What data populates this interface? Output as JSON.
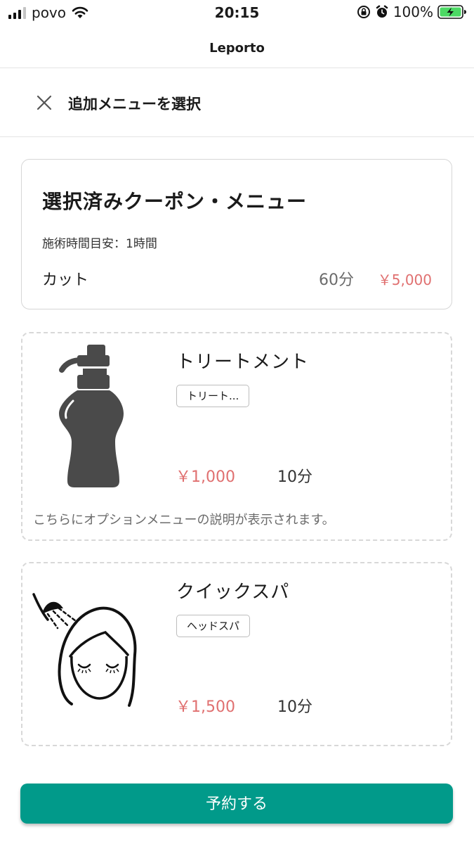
{
  "status_bar": {
    "carrier": "povo",
    "time": "20:15",
    "battery": "100%"
  },
  "app": {
    "title": "Leporto"
  },
  "sub_header": {
    "title": "追加メニューを選択",
    "close_icon": "close-icon"
  },
  "selected": {
    "title": "選択済みクーポン・メニュー",
    "time_estimate": "施術時間目安：1時間",
    "item_name": "カット",
    "item_duration": "60分",
    "item_price": "￥5,000"
  },
  "options": [
    {
      "name": "トリートメント",
      "tag": "トリート...",
      "price": "￥1,000",
      "duration": "10分",
      "description": "こちらにオプションメニューの説明が表示されます。",
      "icon": "bottle-icon"
    },
    {
      "name": "クイックスパ",
      "tag": "ヘッドスパ",
      "price": "￥1,500",
      "duration": "10分",
      "icon": "head-spa-icon"
    }
  ],
  "reserve_button": {
    "label": "予約する"
  },
  "colors": {
    "accent": "#019a8a",
    "price": "#e07070",
    "border": "#d6d6d6"
  }
}
